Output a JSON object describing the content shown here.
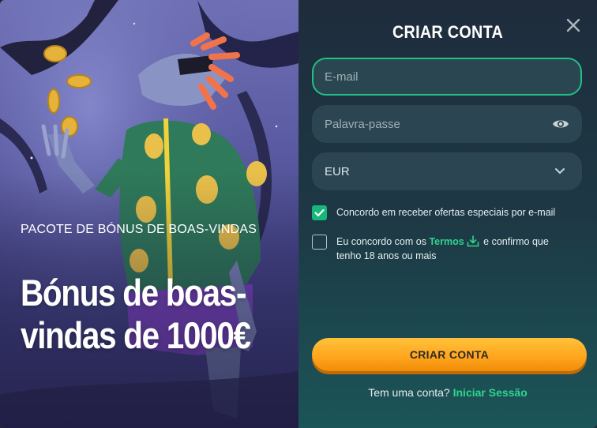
{
  "promo": {
    "subtitle": "PACOTE DE BÓNUS DE BOAS-VINDAS",
    "title": "Bónus de boas-vindas de 1000€"
  },
  "form": {
    "title": "CRIAR CONTA",
    "email_placeholder": "E-mail",
    "password_placeholder": "Palavra-passe",
    "currency_value": "EUR",
    "offers_consent": {
      "checked": true,
      "label": "Concordo em receber ofertas especiais por e-mail"
    },
    "terms_consent": {
      "checked": false,
      "prefix": "Eu concordo com os",
      "link_label": "Termos",
      "suffix": "e confirmo que tenho 18 anos ou mais"
    },
    "submit_label": "CRIAR CONTA",
    "login_prompt": "Tem uma conta?",
    "login_link": "Iniciar Sessão"
  },
  "icons": {
    "close": "close-icon",
    "show_password": "eye-icon",
    "currency_dropdown": "chevron-down-icon",
    "checkmark": "checkmark-icon",
    "terms_download": "download-icon"
  },
  "colors": {
    "accent_green": "#21c087",
    "button_orange": "#ffa41c",
    "panel_dark": "#1e2c3c"
  }
}
